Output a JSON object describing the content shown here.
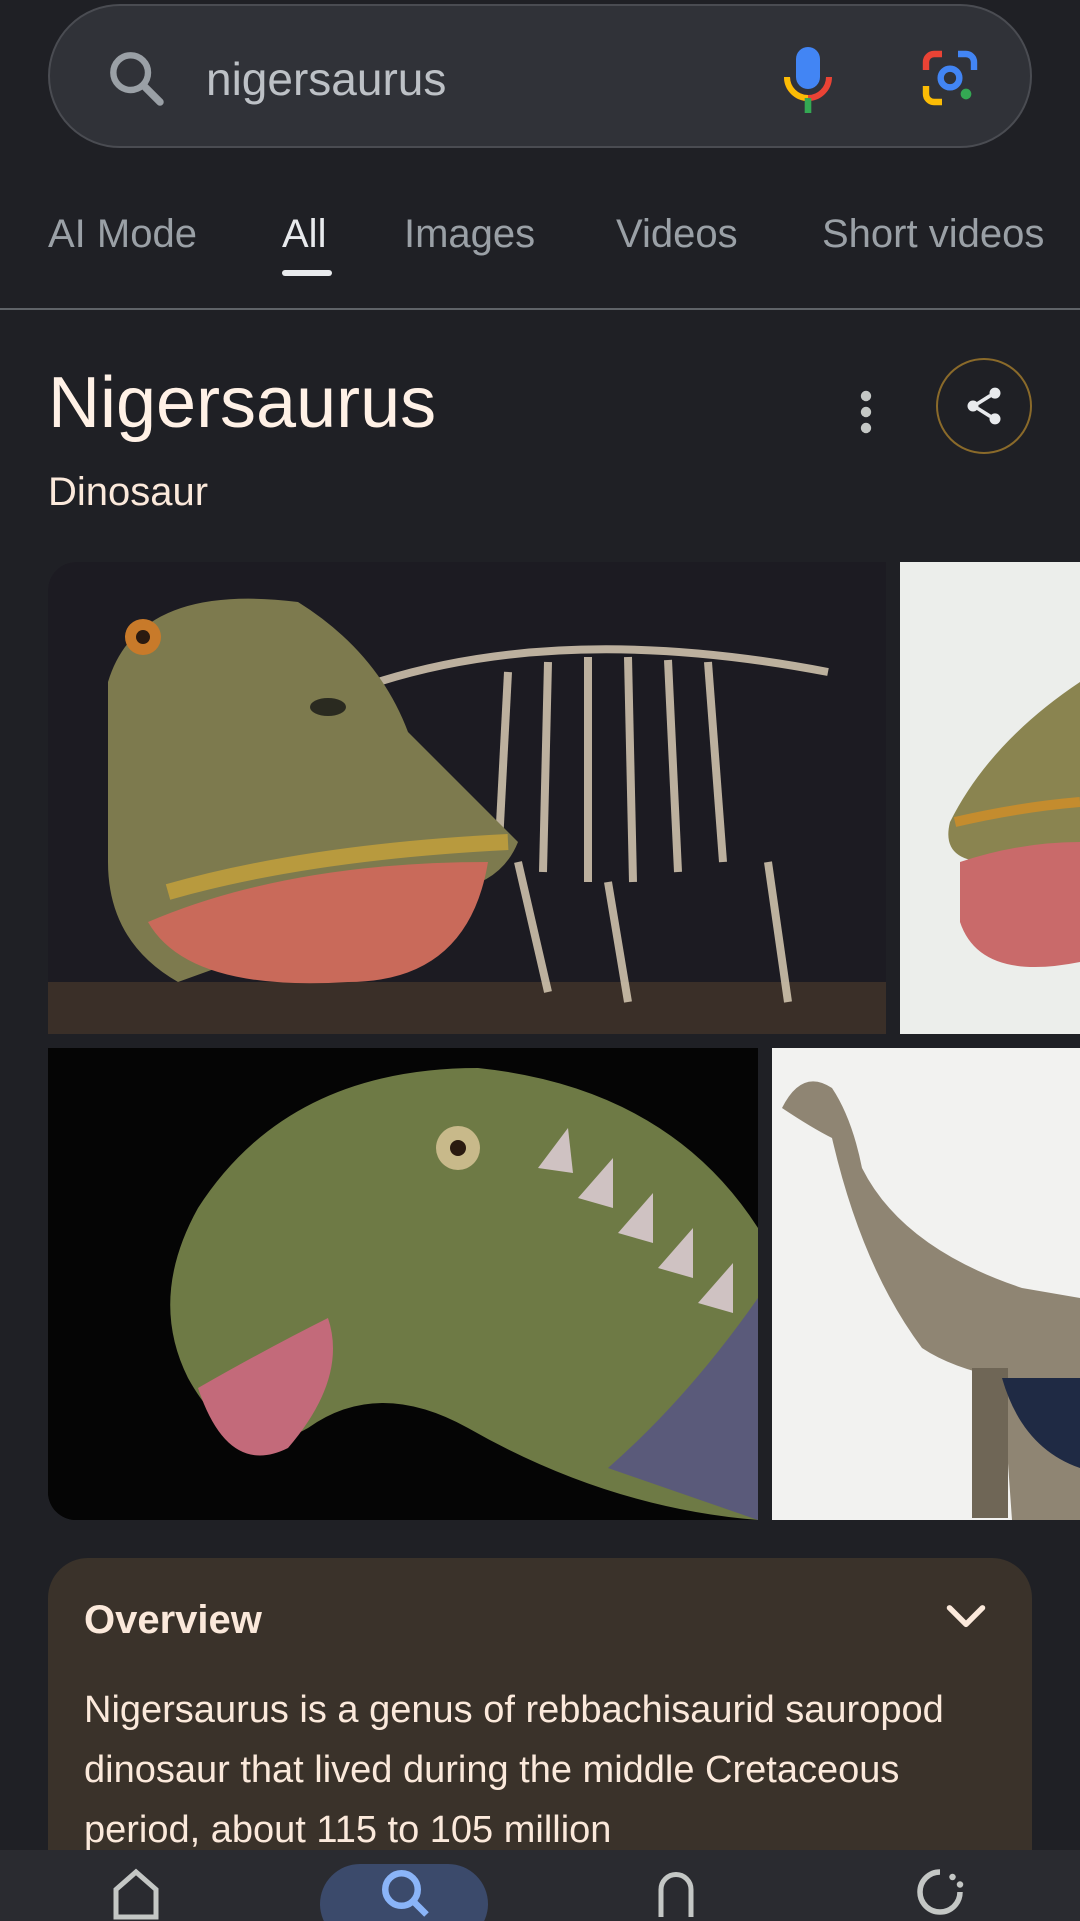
{
  "search": {
    "query": "nigersaurus"
  },
  "tabs": [
    {
      "label": "AI Mode"
    },
    {
      "label": "All"
    },
    {
      "label": "Images"
    },
    {
      "label": "Videos"
    },
    {
      "label": "Short videos"
    }
  ],
  "knowledge_panel": {
    "title": "Nigersaurus",
    "subtitle": "Dinosaur"
  },
  "overview": {
    "title": "Overview",
    "text": "Nigersaurus is a genus of rebbachisaurid sauropod dinosaur that lived during the middle Cretaceous period, about 115 to 105 million"
  },
  "colors": {
    "background": "#1f2025",
    "overview_bg": "#3a322a",
    "accent_blue": "#8ab4f8"
  }
}
